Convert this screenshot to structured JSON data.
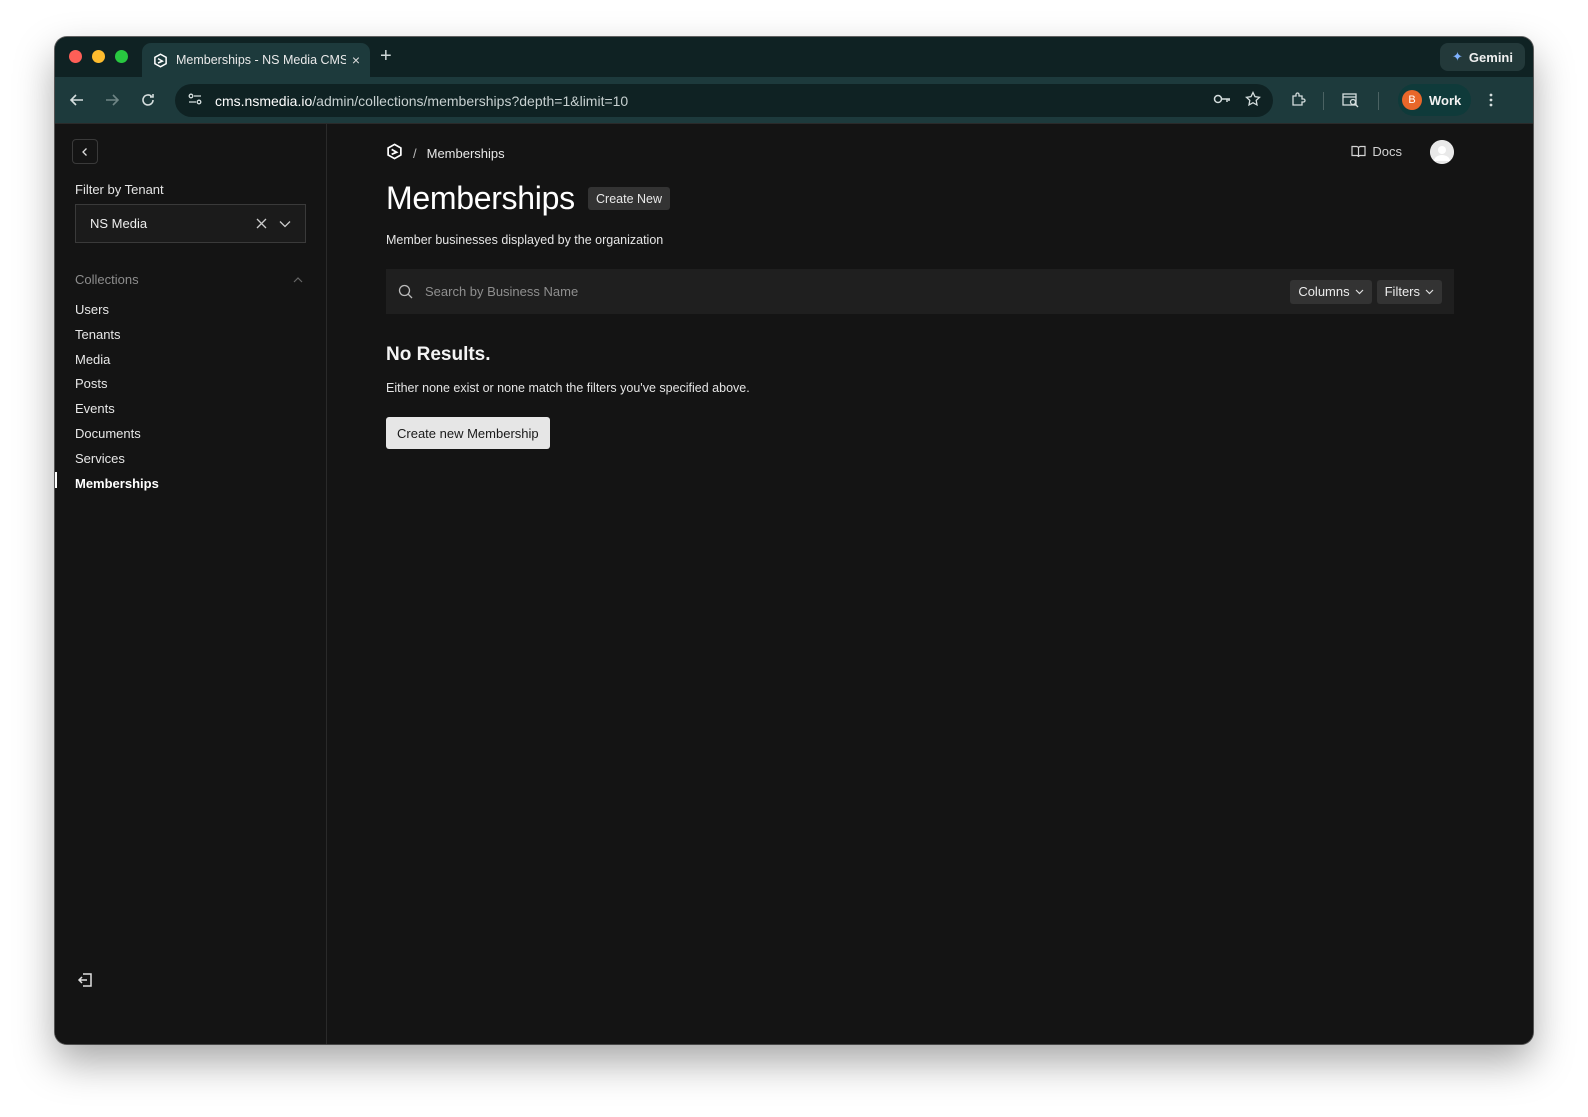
{
  "browser": {
    "tab_title": "Memberships - NS Media CMS",
    "new_tab_symbol": "+",
    "tab_close_symbol": "×",
    "gemini_label": "Gemini",
    "url_host": "cms.nsmedia.io",
    "url_path": "/admin/collections/memberships?depth=1&limit=10",
    "profile_initial": "B",
    "profile_label": "Work"
  },
  "sidebar": {
    "filter_label": "Filter by Tenant",
    "tenant_value": "NS Media",
    "collections_label": "Collections",
    "items": [
      {
        "label": "Users"
      },
      {
        "label": "Tenants"
      },
      {
        "label": "Media"
      },
      {
        "label": "Posts"
      },
      {
        "label": "Events"
      },
      {
        "label": "Documents"
      },
      {
        "label": "Services"
      },
      {
        "label": "Memberships"
      }
    ],
    "active_item": "Memberships"
  },
  "header": {
    "breadcrumb_separator": "/",
    "breadcrumb_current": "Memberships",
    "docs_label": "Docs"
  },
  "main": {
    "title": "Memberships",
    "create_new_label": "Create New",
    "description": "Member businesses displayed by the organization",
    "search_placeholder": "Search by Business Name",
    "columns_label": "Columns",
    "filters_label": "Filters",
    "no_results_title": "No Results.",
    "no_results_text": "Either none exist or none match the filters you've specified above.",
    "create_button_label": "Create new Membership"
  },
  "colors": {
    "background": "#141414",
    "tab_strip": "#0f2223",
    "toolbar": "#1d3a3c",
    "profile_accent": "#e8672a"
  }
}
